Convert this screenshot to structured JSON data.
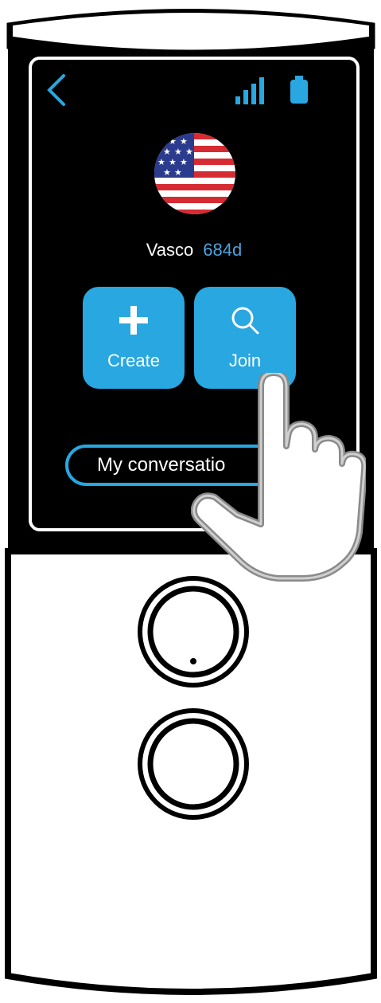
{
  "screen": {
    "user_name": "Vasco",
    "user_days": "684d",
    "create_label": "Create",
    "join_label": "Join",
    "conversations_label": "My conversatio"
  },
  "icons": {
    "back": "chevron-left-icon",
    "signal": "signal-bars-icon",
    "battery": "battery-icon",
    "flag": "us-flag-icon",
    "create": "plus-icon",
    "join": "search-icon",
    "hand": "pointing-hand-icon"
  },
  "colors": {
    "accent": "#28a7e1",
    "screen_bg": "#000000",
    "device_body": "#ffffff",
    "days_text": "#4aa3df"
  }
}
